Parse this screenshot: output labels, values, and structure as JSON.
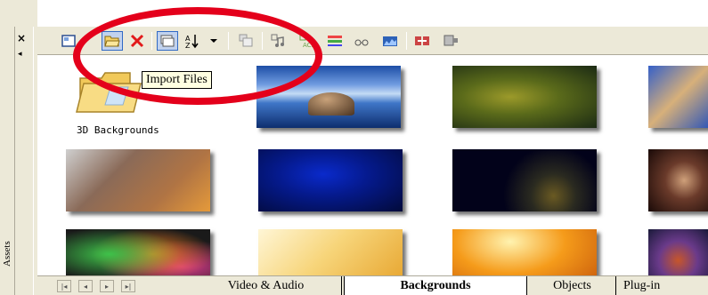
{
  "sidebar": {
    "close_glyph": "×",
    "pin_glyph": "◂",
    "panel_label": "Assets"
  },
  "toolbar": {
    "buttons": [
      {
        "name": "view-mode-icon"
      },
      {
        "name": "open-folder-icon",
        "selected": true
      },
      {
        "name": "delete-icon"
      },
      {
        "name": "import-icon",
        "selected": true
      },
      {
        "name": "sort-icon"
      },
      {
        "name": "dropdown-arrow-icon"
      },
      {
        "name": "clone-icon"
      },
      {
        "name": "audio-tool-icon"
      },
      {
        "name": "ac3-tool-icon"
      },
      {
        "name": "trim-tool-icon"
      },
      {
        "name": "glasses-tool-icon"
      },
      {
        "name": "levels-tool-icon"
      },
      {
        "name": "split-tool-icon"
      },
      {
        "name": "render-tool-icon"
      }
    ]
  },
  "tooltip": {
    "text": "Import Files"
  },
  "folder": {
    "label": "3D Backgrounds"
  },
  "tabs": {
    "nav_buttons": [
      "|◂",
      "◂",
      "▸",
      "▸|"
    ],
    "items": [
      {
        "label": "Video & Audio",
        "active": false
      },
      {
        "label": "Backgrounds",
        "active": true
      },
      {
        "label": "Objects",
        "active": false
      },
      {
        "label": "Plug-in",
        "active": false
      }
    ]
  },
  "colors": {
    "annotation": "#e4001b",
    "tooltip_bg": "#ffffe1",
    "toolbar_bg": "#ece9d8"
  }
}
